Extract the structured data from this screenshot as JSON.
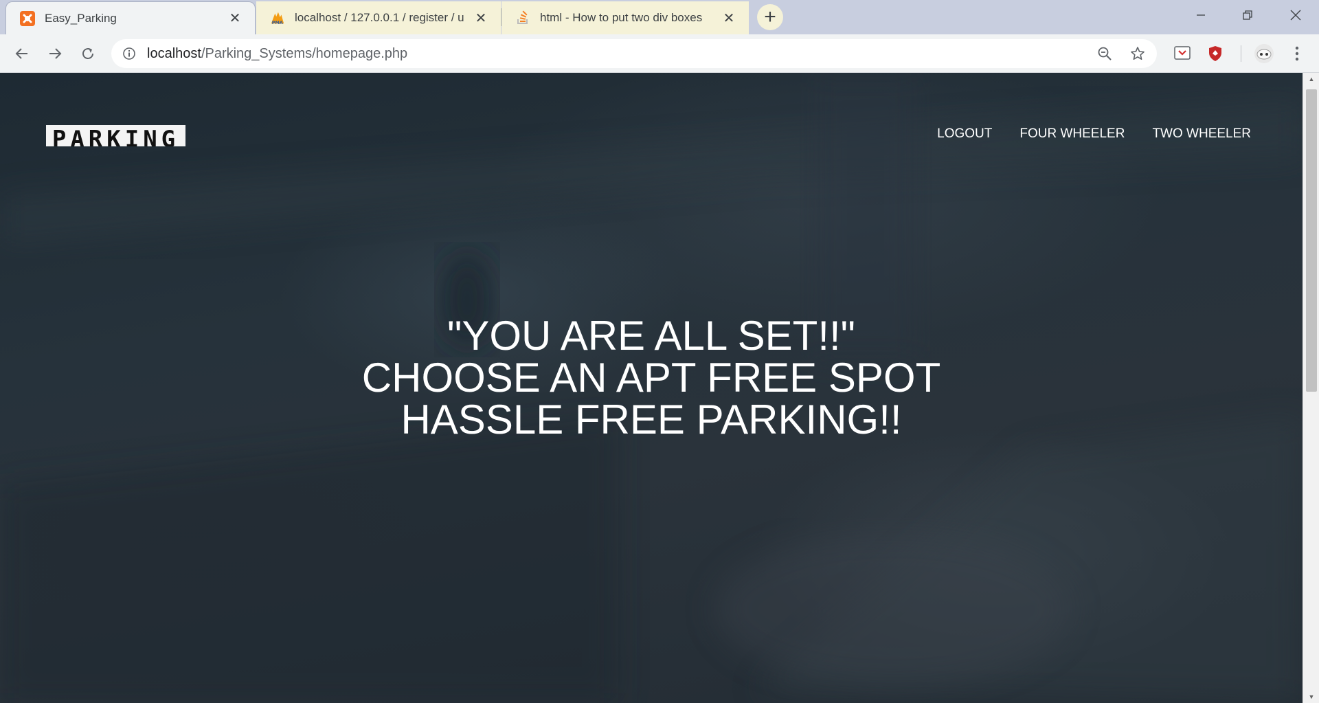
{
  "browser": {
    "tabs": [
      {
        "title": "Easy_Parking",
        "favicon": "xampp-icon",
        "active": true
      },
      {
        "title": "localhost / 127.0.0.1 / register / u",
        "favicon": "phpmyadmin-icon",
        "active": false
      },
      {
        "title": "html - How to put two div boxes",
        "favicon": "stackoverflow-icon",
        "active": false
      }
    ],
    "new_tab_label": "+",
    "address": {
      "host": "localhost",
      "path": "/Parking_Systems/homepage.php"
    }
  },
  "page": {
    "logo_text": "PARKING",
    "nav": [
      "LOGOUT",
      "FOUR WHEELER",
      "TWO WHEELER"
    ],
    "hero_lines": [
      "\"YOU ARE ALL SET!!\"",
      "CHOOSE AN APT FREE SPOT",
      "HASSLE FREE PARKING!!"
    ]
  },
  "colors": {
    "tabstrip": "#c8cedf",
    "active_tab": "#f1f3f4",
    "inactive_tab": "#f5f2d8",
    "page_background": "#222b33",
    "text": "#ffffff"
  }
}
